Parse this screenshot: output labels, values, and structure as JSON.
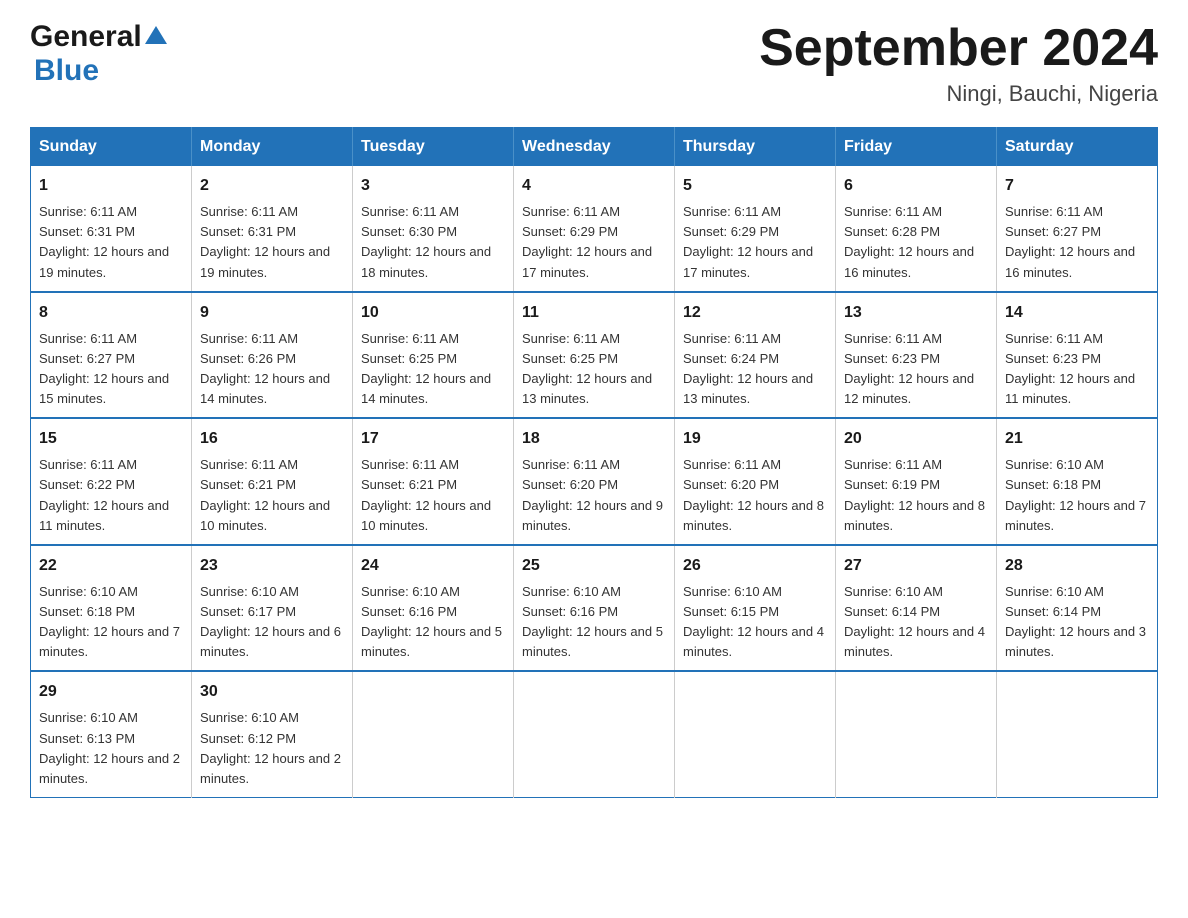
{
  "logo": {
    "general": "General",
    "triangle": "▲",
    "blue": "Blue"
  },
  "title": {
    "month_year": "September 2024",
    "location": "Ningi, Bauchi, Nigeria"
  },
  "headers": [
    "Sunday",
    "Monday",
    "Tuesday",
    "Wednesday",
    "Thursday",
    "Friday",
    "Saturday"
  ],
  "weeks": [
    [
      {
        "day": "1",
        "sunrise": "6:11 AM",
        "sunset": "6:31 PM",
        "daylight": "12 hours and 19 minutes."
      },
      {
        "day": "2",
        "sunrise": "6:11 AM",
        "sunset": "6:31 PM",
        "daylight": "12 hours and 19 minutes."
      },
      {
        "day": "3",
        "sunrise": "6:11 AM",
        "sunset": "6:30 PM",
        "daylight": "12 hours and 18 minutes."
      },
      {
        "day": "4",
        "sunrise": "6:11 AM",
        "sunset": "6:29 PM",
        "daylight": "12 hours and 17 minutes."
      },
      {
        "day": "5",
        "sunrise": "6:11 AM",
        "sunset": "6:29 PM",
        "daylight": "12 hours and 17 minutes."
      },
      {
        "day": "6",
        "sunrise": "6:11 AM",
        "sunset": "6:28 PM",
        "daylight": "12 hours and 16 minutes."
      },
      {
        "day": "7",
        "sunrise": "6:11 AM",
        "sunset": "6:27 PM",
        "daylight": "12 hours and 16 minutes."
      }
    ],
    [
      {
        "day": "8",
        "sunrise": "6:11 AM",
        "sunset": "6:27 PM",
        "daylight": "12 hours and 15 minutes."
      },
      {
        "day": "9",
        "sunrise": "6:11 AM",
        "sunset": "6:26 PM",
        "daylight": "12 hours and 14 minutes."
      },
      {
        "day": "10",
        "sunrise": "6:11 AM",
        "sunset": "6:25 PM",
        "daylight": "12 hours and 14 minutes."
      },
      {
        "day": "11",
        "sunrise": "6:11 AM",
        "sunset": "6:25 PM",
        "daylight": "12 hours and 13 minutes."
      },
      {
        "day": "12",
        "sunrise": "6:11 AM",
        "sunset": "6:24 PM",
        "daylight": "12 hours and 13 minutes."
      },
      {
        "day": "13",
        "sunrise": "6:11 AM",
        "sunset": "6:23 PM",
        "daylight": "12 hours and 12 minutes."
      },
      {
        "day": "14",
        "sunrise": "6:11 AM",
        "sunset": "6:23 PM",
        "daylight": "12 hours and 11 minutes."
      }
    ],
    [
      {
        "day": "15",
        "sunrise": "6:11 AM",
        "sunset": "6:22 PM",
        "daylight": "12 hours and 11 minutes."
      },
      {
        "day": "16",
        "sunrise": "6:11 AM",
        "sunset": "6:21 PM",
        "daylight": "12 hours and 10 minutes."
      },
      {
        "day": "17",
        "sunrise": "6:11 AM",
        "sunset": "6:21 PM",
        "daylight": "12 hours and 10 minutes."
      },
      {
        "day": "18",
        "sunrise": "6:11 AM",
        "sunset": "6:20 PM",
        "daylight": "12 hours and 9 minutes."
      },
      {
        "day": "19",
        "sunrise": "6:11 AM",
        "sunset": "6:20 PM",
        "daylight": "12 hours and 8 minutes."
      },
      {
        "day": "20",
        "sunrise": "6:11 AM",
        "sunset": "6:19 PM",
        "daylight": "12 hours and 8 minutes."
      },
      {
        "day": "21",
        "sunrise": "6:10 AM",
        "sunset": "6:18 PM",
        "daylight": "12 hours and 7 minutes."
      }
    ],
    [
      {
        "day": "22",
        "sunrise": "6:10 AM",
        "sunset": "6:18 PM",
        "daylight": "12 hours and 7 minutes."
      },
      {
        "day": "23",
        "sunrise": "6:10 AM",
        "sunset": "6:17 PM",
        "daylight": "12 hours and 6 minutes."
      },
      {
        "day": "24",
        "sunrise": "6:10 AM",
        "sunset": "6:16 PM",
        "daylight": "12 hours and 5 minutes."
      },
      {
        "day": "25",
        "sunrise": "6:10 AM",
        "sunset": "6:16 PM",
        "daylight": "12 hours and 5 minutes."
      },
      {
        "day": "26",
        "sunrise": "6:10 AM",
        "sunset": "6:15 PM",
        "daylight": "12 hours and 4 minutes."
      },
      {
        "day": "27",
        "sunrise": "6:10 AM",
        "sunset": "6:14 PM",
        "daylight": "12 hours and 4 minutes."
      },
      {
        "day": "28",
        "sunrise": "6:10 AM",
        "sunset": "6:14 PM",
        "daylight": "12 hours and 3 minutes."
      }
    ],
    [
      {
        "day": "29",
        "sunrise": "6:10 AM",
        "sunset": "6:13 PM",
        "daylight": "12 hours and 2 minutes."
      },
      {
        "day": "30",
        "sunrise": "6:10 AM",
        "sunset": "6:12 PM",
        "daylight": "12 hours and 2 minutes."
      },
      null,
      null,
      null,
      null,
      null
    ]
  ]
}
